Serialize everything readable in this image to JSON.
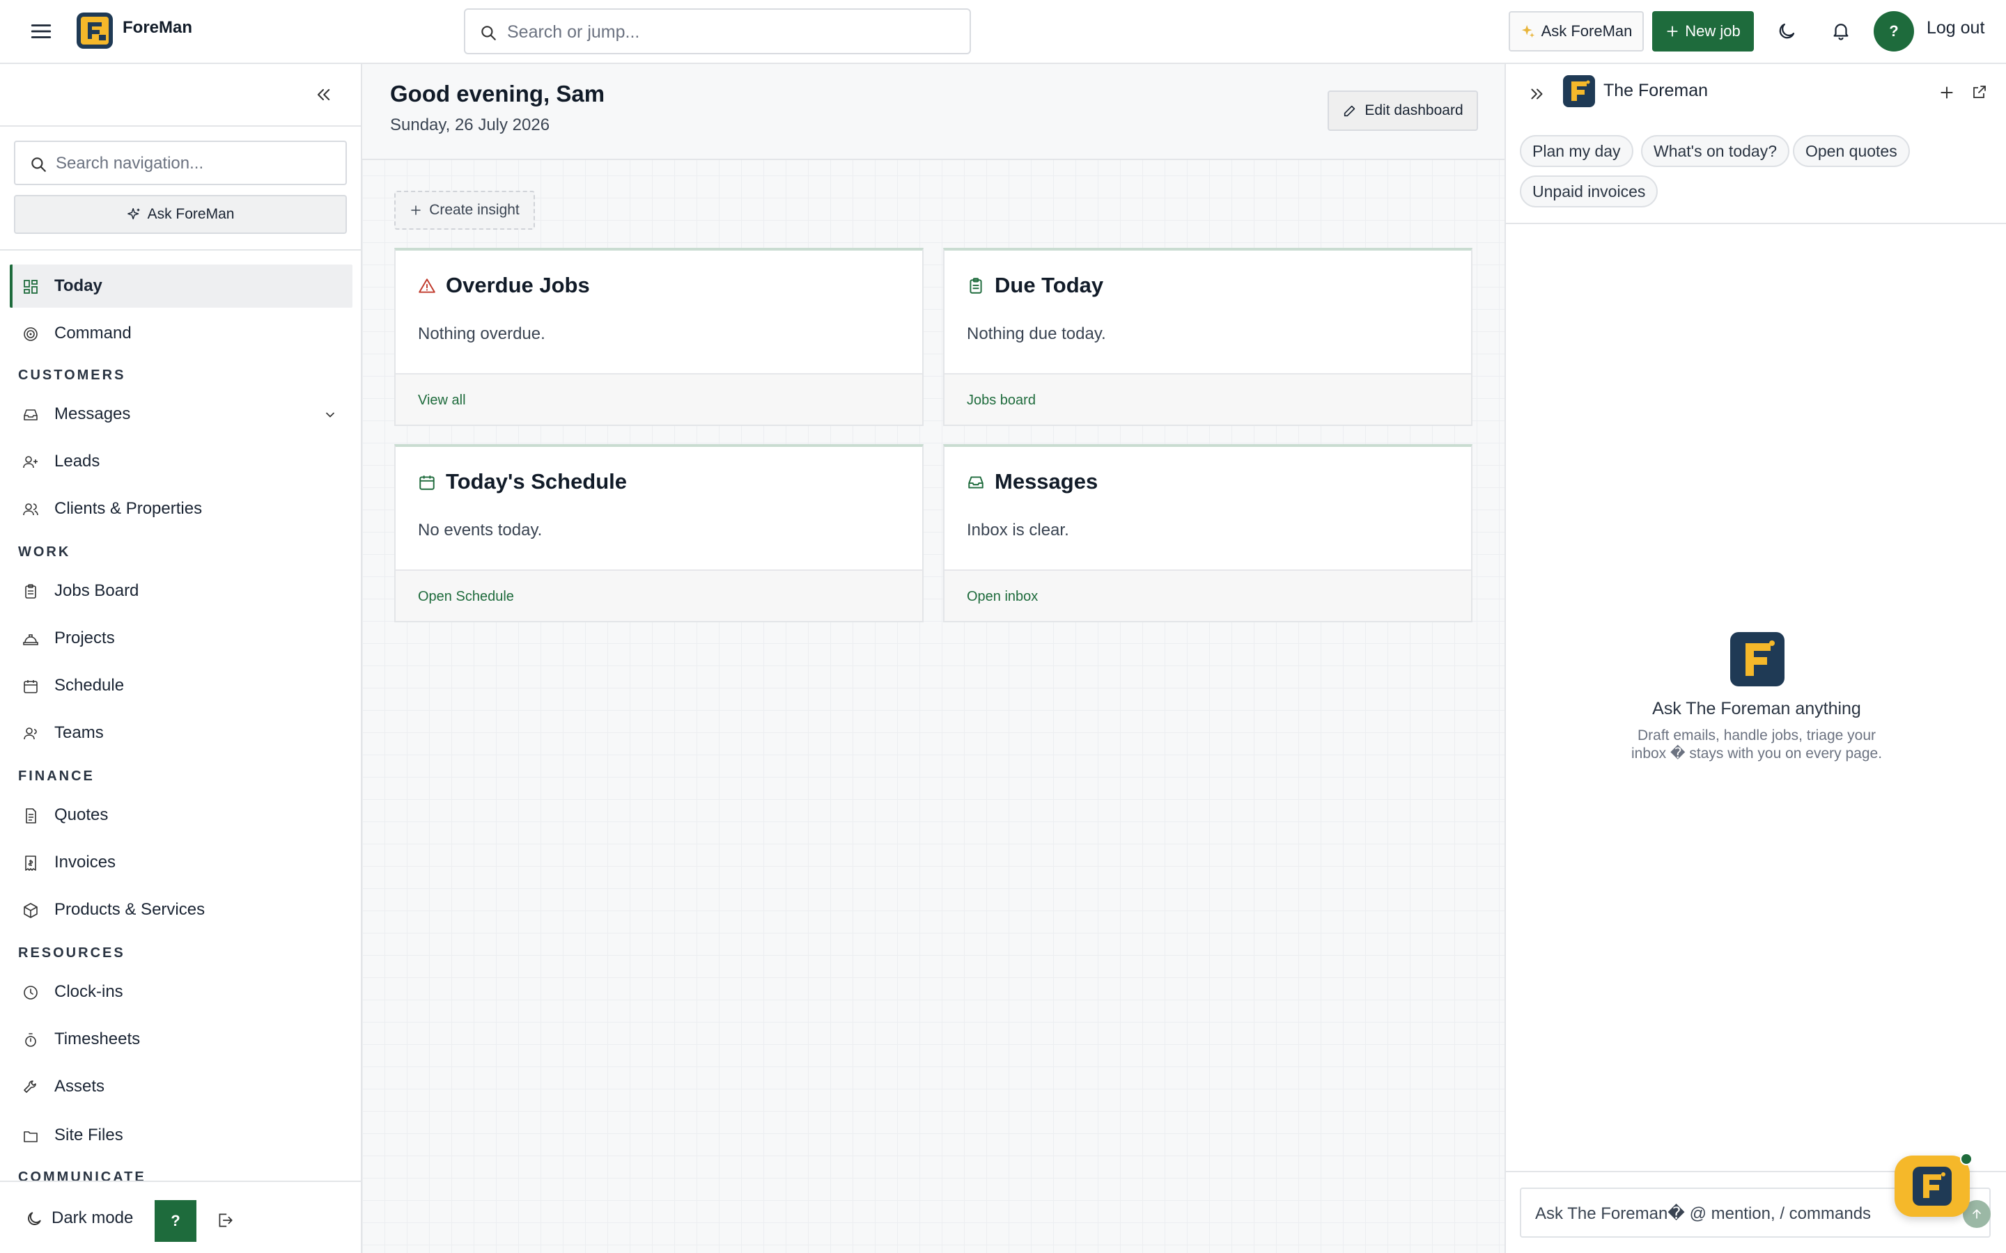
{
  "app": {
    "name": "ForeMan"
  },
  "topbar": {
    "search_placeholder": "Search or jump...",
    "ask_label": "Ask ForeMan",
    "new_job_label": "New job",
    "avatar_initial": "?",
    "logout_label": "Log out"
  },
  "sidebar": {
    "search_placeholder": "Search navigation...",
    "ask_label": "Ask ForeMan",
    "items": {
      "today": "Today",
      "command": "Command",
      "customers_section": "CUSTOMERS",
      "messages": "Messages",
      "leads": "Leads",
      "clients": "Clients & Properties",
      "work_section": "WORK",
      "jobs_board": "Jobs Board",
      "projects": "Projects",
      "schedule": "Schedule",
      "teams": "Teams",
      "finance_section": "FINANCE",
      "quotes": "Quotes",
      "invoices": "Invoices",
      "products": "Products & Services",
      "resources_section": "RESOURCES",
      "clockins": "Clock-ins",
      "timesheets": "Timesheets",
      "assets": "Assets",
      "site_files": "Site Files",
      "communicate_section": "COMMUNICATE"
    },
    "footer": {
      "dark_mode_label": "Dark mode",
      "help_label": "?"
    }
  },
  "main": {
    "greeting": "Good evening, Sam",
    "date": "Sunday, 26 July 2026",
    "edit_dashboard_label": "Edit dashboard",
    "create_insight_label": "Create insight",
    "cards": [
      {
        "title": "Overdue Jobs",
        "body": "Nothing overdue.",
        "link": "View all"
      },
      {
        "title": "Due Today",
        "body": "Nothing due today.",
        "link": "Jobs board"
      },
      {
        "title": "Today's Schedule",
        "body": "No events today.",
        "link": "Open Schedule"
      },
      {
        "title": "Messages",
        "body": "Inbox is clear.",
        "link": "Open inbox"
      }
    ]
  },
  "assistant": {
    "title": "The Foreman",
    "chips": [
      "Plan my day",
      "What's on today?",
      "Open quotes",
      "Unpaid invoices"
    ],
    "empty_title": "Ask The Foreman anything",
    "empty_subtitle": "Draft emails, handle jobs, triage your inbox � stays with you on every page.",
    "input_placeholder": "Ask The Foreman� @ mention, / commands"
  },
  "colors": {
    "accent": "#1e6b3c",
    "brand_dark": "#1f3a55",
    "brand_yellow": "#f5b82a",
    "danger_icon": "#c0392b"
  }
}
